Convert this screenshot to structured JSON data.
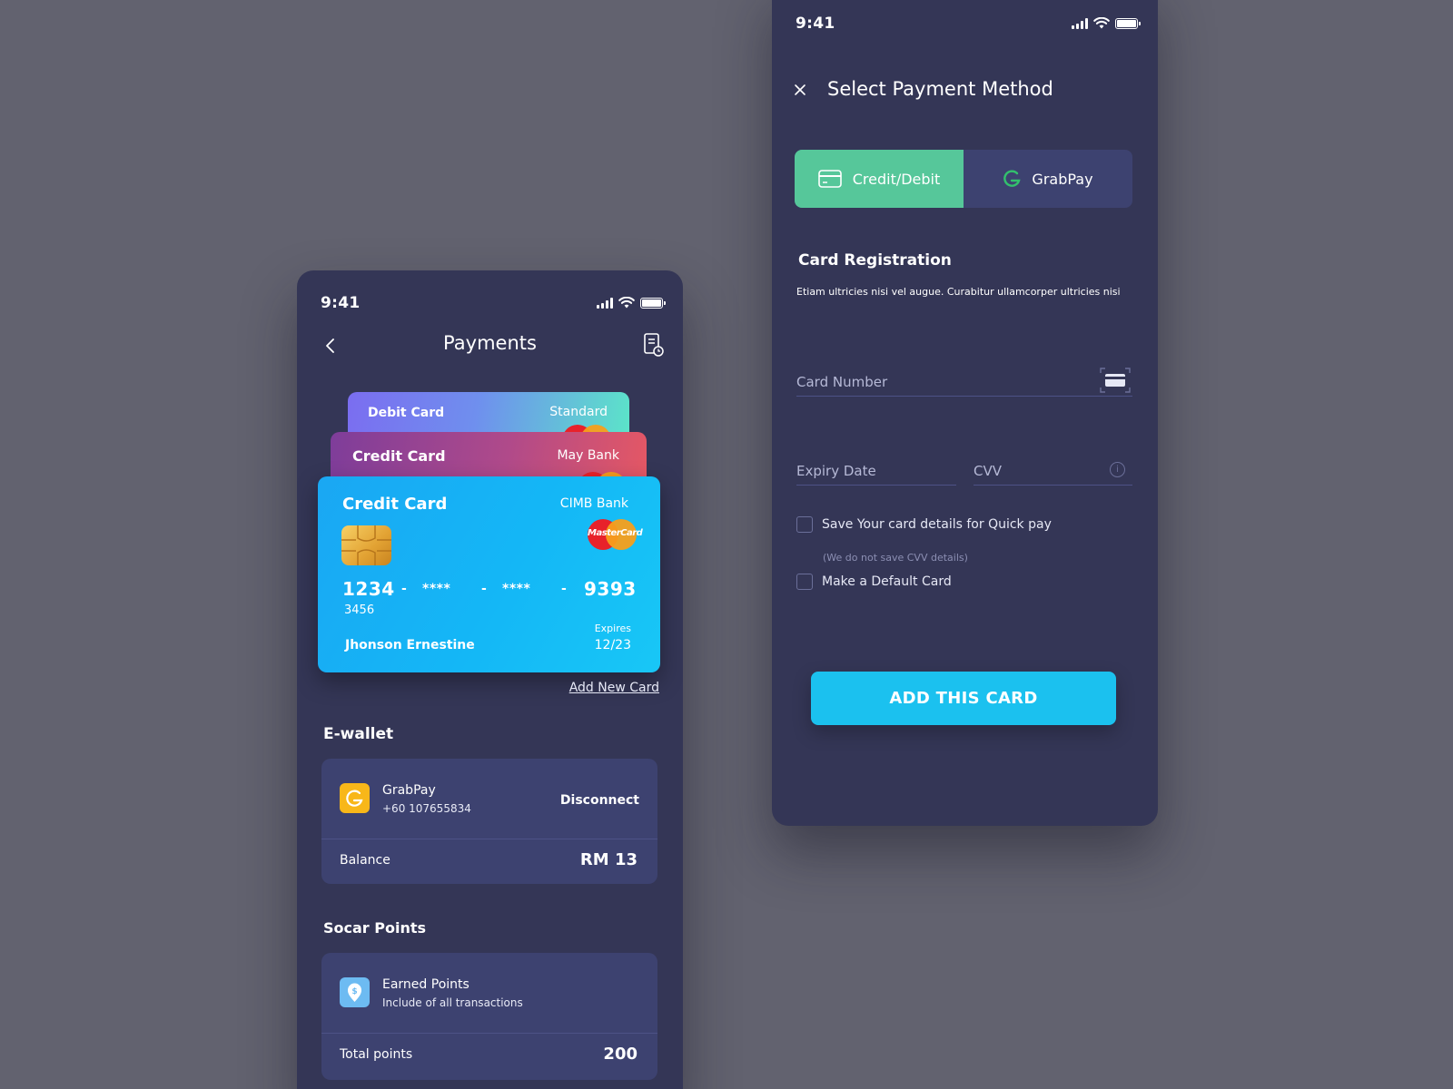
{
  "left": {
    "status": {
      "time": "9:41"
    },
    "header": {
      "title": "Payments"
    },
    "cards": [
      {
        "label": "Debit Card",
        "bank": "Standard",
        "gradient": [
          "#7b6df0",
          "#5be6c8"
        ]
      },
      {
        "label": "Credit Card",
        "bank": "May Bank",
        "gradient": [
          "#7e3d9a",
          "#e65863"
        ]
      },
      {
        "label": "Credit Card",
        "bank": "CIMB Bank",
        "brand": "MasterCard",
        "number": [
          "1234",
          "-",
          "****",
          "-",
          "****",
          "-",
          "9393"
        ],
        "number_extra": "3456",
        "holder": "Jhonson Ernestine",
        "expires_label": "Expires",
        "expires": "12/23",
        "gradient": [
          "#1aa7f3",
          "#18c7f6"
        ]
      }
    ],
    "add_card_link": "Add New Card",
    "ewallet": {
      "title": "E-wallet",
      "provider": "GrabPay",
      "phone": "+60 107655834",
      "action": "Disconnect",
      "balance_label": "Balance",
      "balance_value": "RM 13"
    },
    "points": {
      "title": "Socar Points",
      "name": "Earned Points",
      "sub": "Include of all transactions",
      "total_label": "Total points",
      "total_value": "200"
    },
    "icons": {
      "back": "chevron-left-icon",
      "receipt": "receipt-clock-icon",
      "grab": "grab-logo-icon",
      "points": "dollar-pin-icon"
    }
  },
  "right": {
    "status": {
      "time": "9:41"
    },
    "title": "Select Payment Method",
    "tabs": [
      {
        "label": "Credit/Debit",
        "active": true
      },
      {
        "label": "GrabPay",
        "active": false
      }
    ],
    "registration": {
      "title": "Card Registration",
      "description": "Etiam ultricies nisi vel augue. Curabitur ullamcorper ultricies nisi"
    },
    "fields": {
      "card_number_placeholder": "Card Number",
      "expiry_placeholder": "Expiry Date",
      "cvv_placeholder": "CVV"
    },
    "checkboxes": {
      "save_label": "Save Your card details for Quick pay",
      "save_note": "(We do not save CVV details)",
      "default_label": "Make a Default Card"
    },
    "cta": "ADD THIS CARD",
    "icons": {
      "close": "close-icon",
      "card": "credit-card-icon",
      "scan": "card-scan-icon",
      "info": "info-icon"
    }
  },
  "colors": {
    "background": "#62626f",
    "panel": "#343656",
    "surface": "#3d4270",
    "accent_green": "#56c79a",
    "accent_cyan": "#1bc1ef"
  }
}
